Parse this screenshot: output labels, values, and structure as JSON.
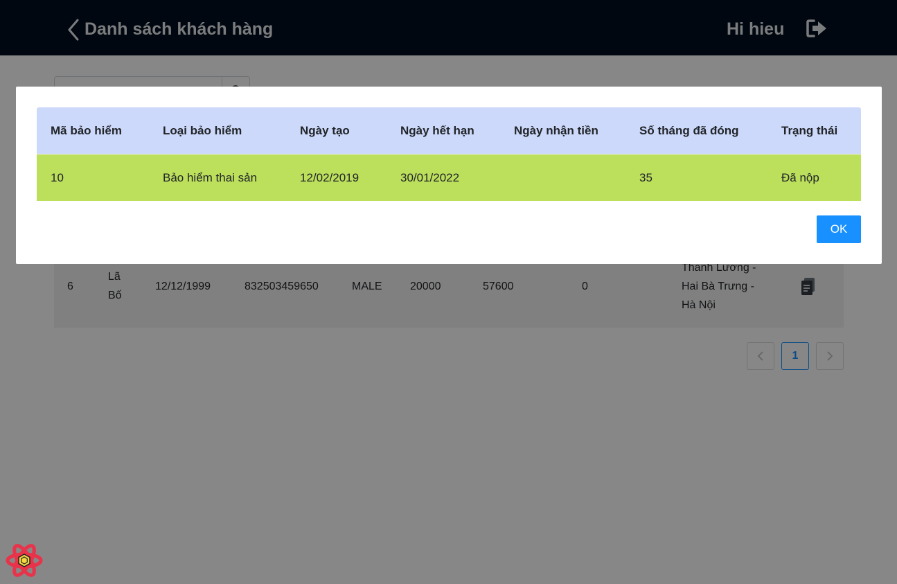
{
  "header": {
    "title": "Danh sách khách hàng",
    "greeting": "Hi hieu",
    "back_icon": "chevron-left-icon",
    "logout_icon": "sign-out-icon"
  },
  "customer_row": {
    "index": "6",
    "name_line1": "Lã",
    "name_line2": "Bố",
    "birth_date": "12/12/1999",
    "id_number": "832503459650",
    "gender": "MALE",
    "value_a": "20000",
    "value_b": "57600",
    "value_c": "0",
    "address_line1": "Thanh Lương -",
    "address_line2": "Hai Bà Trưng -",
    "address_line3": "Hà Nội",
    "action_icon": "document-icon"
  },
  "pagination": {
    "prev_icon": "chevron-left-icon",
    "current_page": "1",
    "next_icon": "chevron-right-icon"
  },
  "modal": {
    "columns": [
      "Mã bảo hiểm",
      "Loại bảo hiểm",
      "Ngày tạo",
      "Ngày hết hạn",
      "Ngày nhận tiền",
      "Số tháng đã đóng",
      "Trạng thái"
    ],
    "rows": [
      [
        "10",
        "Bảo hiểm thai sản",
        "12/02/2019",
        "30/01/2022",
        "",
        "35",
        "Đã nộp"
      ]
    ],
    "ok_label": "OK"
  },
  "colors": {
    "topbar": "#010f1f",
    "table_header": "#cdd9fa",
    "highlight_row": "#bcdf5c",
    "primary": "#1890ff"
  }
}
